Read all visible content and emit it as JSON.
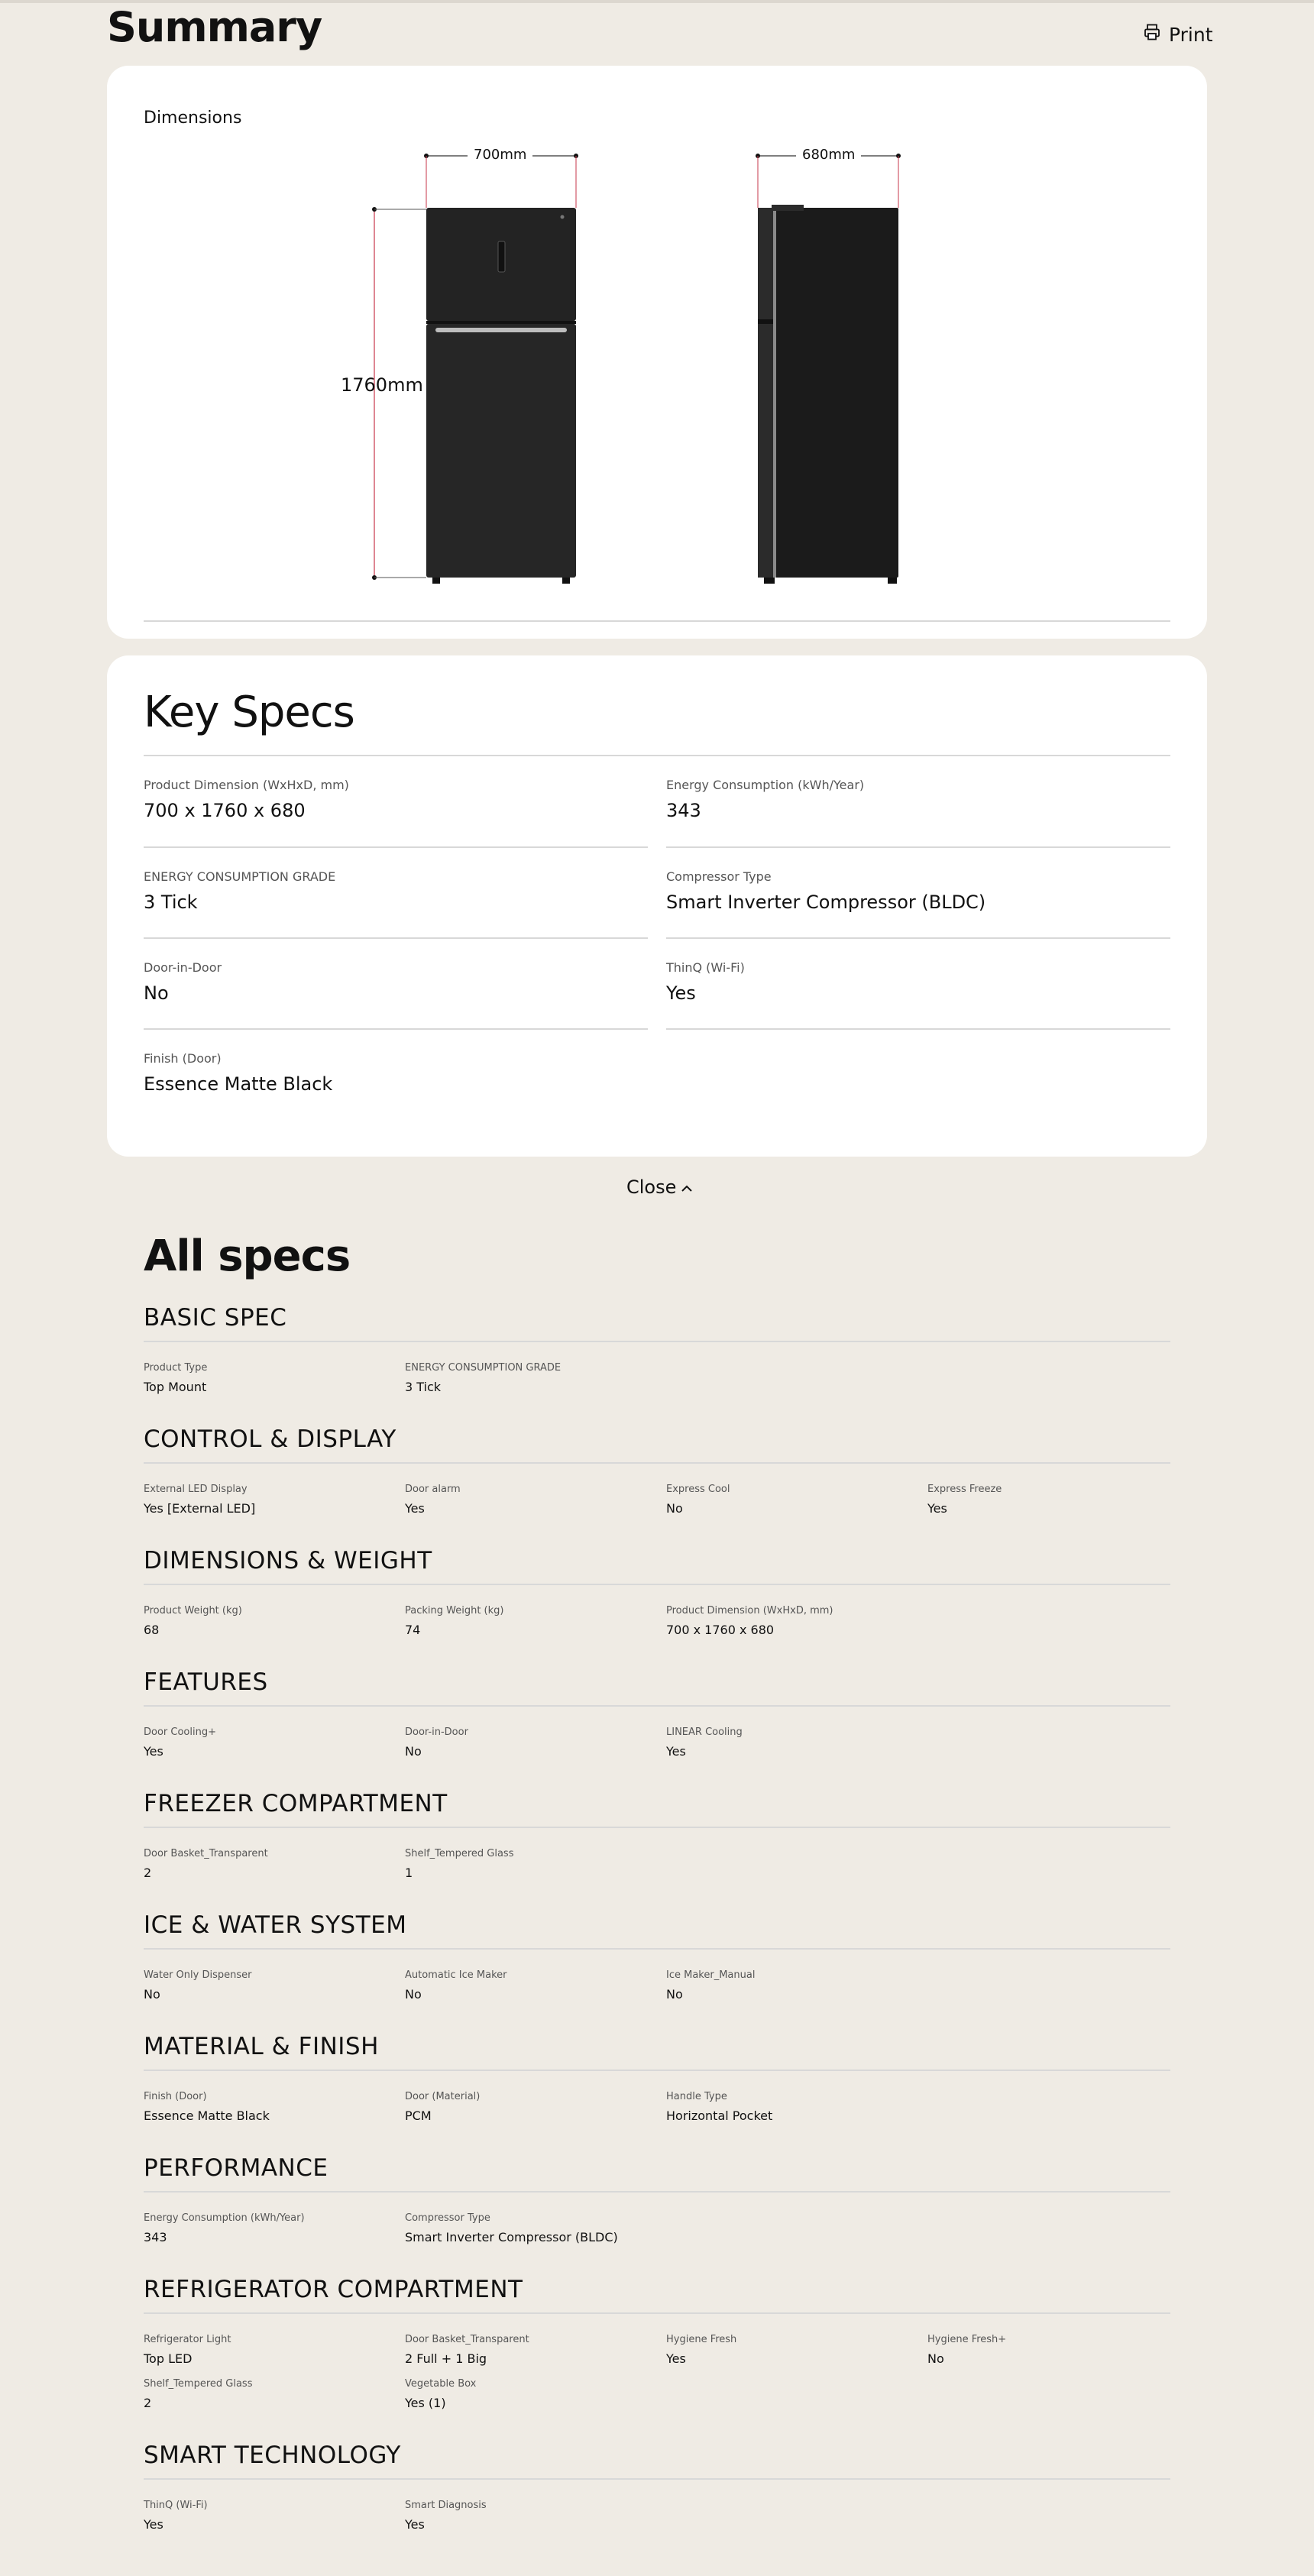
{
  "summary": {
    "title": "Summary",
    "print_label": "Print"
  },
  "dimensions": {
    "label": "Dimensions",
    "width": "700mm",
    "depth": "680mm",
    "height": "1760mm"
  },
  "key_specs": {
    "title": "Key Specs",
    "items": [
      {
        "label": "Product Dimension (WxHxD, mm)",
        "value": "700 x 1760 x 680"
      },
      {
        "label": "Energy Consumption (kWh/Year)",
        "value": "343"
      },
      {
        "label": "ENERGY CONSUMPTION GRADE",
        "value": "3 Tick"
      },
      {
        "label": "Compressor Type",
        "value": "Smart Inverter Compressor (BLDC)"
      },
      {
        "label": "Door-in-Door",
        "value": "No"
      },
      {
        "label": "ThinQ (Wi-Fi)",
        "value": "Yes"
      },
      {
        "label": "Finish (Door)",
        "value": "Essence Matte Black"
      }
    ]
  },
  "close_label": "Close",
  "all_specs": {
    "title": "All specs",
    "groups": [
      {
        "title": "BASIC SPEC",
        "items": [
          {
            "label": "Product Type",
            "value": "Top Mount"
          },
          {
            "label": "ENERGY CONSUMPTION GRADE",
            "value": "3 Tick"
          }
        ]
      },
      {
        "title": "CONTROL & DISPLAY",
        "items": [
          {
            "label": "External LED Display",
            "value": "Yes [External LED]"
          },
          {
            "label": "Door alarm",
            "value": "Yes"
          },
          {
            "label": "Express Cool",
            "value": "No"
          },
          {
            "label": "Express Freeze",
            "value": "Yes"
          }
        ]
      },
      {
        "title": "DIMENSIONS & WEIGHT",
        "items": [
          {
            "label": "Product Weight (kg)",
            "value": "68"
          },
          {
            "label": "Packing Weight (kg)",
            "value": "74"
          },
          {
            "label": "Product Dimension (WxHxD, mm)",
            "value": "700 x 1760 x 680"
          }
        ]
      },
      {
        "title": "FEATURES",
        "items": [
          {
            "label": "Door Cooling+",
            "value": "Yes"
          },
          {
            "label": "Door-in-Door",
            "value": "No"
          },
          {
            "label": "LINEAR Cooling",
            "value": "Yes"
          }
        ]
      },
      {
        "title": "FREEZER COMPARTMENT",
        "items": [
          {
            "label": "Door Basket_Transparent",
            "value": "2"
          },
          {
            "label": "Shelf_Tempered Glass",
            "value": "1"
          }
        ]
      },
      {
        "title": "ICE & WATER SYSTEM",
        "items": [
          {
            "label": "Water Only Dispenser",
            "value": "No"
          },
          {
            "label": "Automatic Ice Maker",
            "value": "No"
          },
          {
            "label": "Ice Maker_Manual",
            "value": "No"
          }
        ]
      },
      {
        "title": "MATERIAL & FINISH",
        "items": [
          {
            "label": "Finish (Door)",
            "value": "Essence Matte Black"
          },
          {
            "label": "Door (Material)",
            "value": "PCM"
          },
          {
            "label": "Handle Type",
            "value": "Horizontal Pocket"
          }
        ]
      },
      {
        "title": "PERFORMANCE",
        "items": [
          {
            "label": "Energy Consumption (kWh/Year)",
            "value": "343"
          },
          {
            "label": "Compressor Type",
            "value": "Smart Inverter Compressor (BLDC)"
          }
        ]
      },
      {
        "title": "REFRIGERATOR COMPARTMENT",
        "items": [
          {
            "label": "Refrigerator Light",
            "value": "Top LED"
          },
          {
            "label": "Door Basket_Transparent",
            "value": "2 Full + 1 Big"
          },
          {
            "label": "Hygiene Fresh",
            "value": "Yes"
          },
          {
            "label": "Hygiene Fresh+",
            "value": "No"
          },
          {
            "label": "Shelf_Tempered Glass",
            "value": "2"
          },
          {
            "label": "Vegetable Box",
            "value": "Yes (1)"
          }
        ]
      },
      {
        "title": "SMART TECHNOLOGY",
        "items": [
          {
            "label": "ThinQ (Wi-Fi)",
            "value": "Yes"
          },
          {
            "label": "Smart Diagnosis",
            "value": "Yes"
          }
        ]
      }
    ]
  }
}
